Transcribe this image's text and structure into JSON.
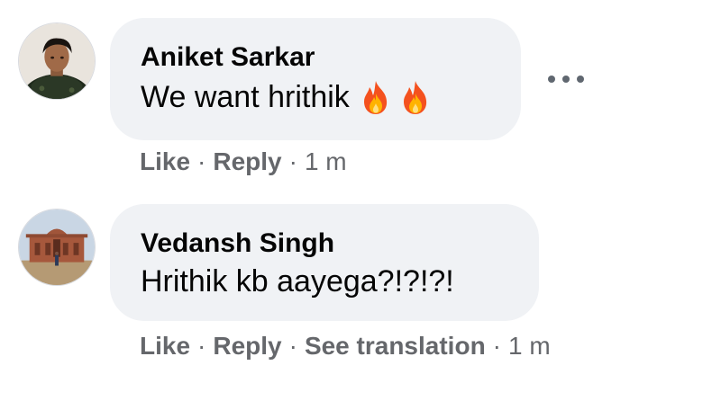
{
  "comments": [
    {
      "author": "Aniket Sarkar",
      "text": "We want hrithik",
      "emojis": [
        "fire-emoji",
        "fire-emoji"
      ],
      "actions": {
        "like": "Like",
        "reply": "Reply",
        "time": "1 m"
      }
    },
    {
      "author": "Vedansh Singh",
      "text": "Hrithik kb aayega?!?!?!",
      "actions": {
        "like": "Like",
        "reply": "Reply",
        "see_translation": "See translation",
        "time": "1 m"
      }
    }
  ],
  "separator": "·",
  "colors": {
    "bubble": "#f0f2f5",
    "meta": "#65676b",
    "text": "#050505"
  }
}
